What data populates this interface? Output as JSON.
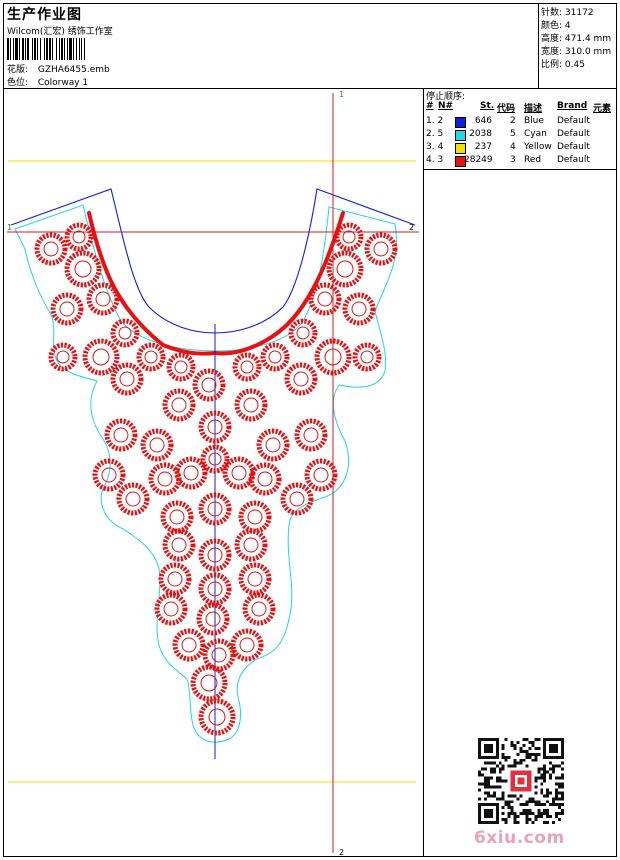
{
  "header": {
    "title": "生产作业图",
    "company": "Wilcom(汇宏) 绣饰工作室",
    "design_label": "花版:",
    "design_value": "GZHA6455.emb",
    "colorway_label": "色位:",
    "colorway_value": "Colorway 1"
  },
  "stats": [
    {
      "label": "针数:",
      "value": "31172"
    },
    {
      "label": "颜色:",
      "value": "4"
    },
    {
      "label": "高度:",
      "value": "471.4 mm"
    },
    {
      "label": "宽度:",
      "value": "310.0 mm"
    },
    {
      "label": "比例:",
      "value": "0.45"
    }
  ],
  "stop_sequence": {
    "title": "停止顺序:",
    "columns": [
      "#",
      "N#",
      "St.",
      "代码",
      "描述",
      "Brand",
      "元素"
    ],
    "rows": [
      {
        "no": "1. 2",
        "color": "#1020d8",
        "stitches": "646",
        "code": "2",
        "desc": "Blue",
        "brand": "Default"
      },
      {
        "no": "2. 5",
        "color": "#22d6e8",
        "stitches": "2038",
        "code": "5",
        "desc": "Cyan",
        "brand": "Default"
      },
      {
        "no": "3. 4",
        "color": "#f0e000",
        "stitches": "237",
        "code": "4",
        "desc": "Yellow",
        "brand": "Default"
      },
      {
        "no": "4. 3",
        "color": "#e81010",
        "stitches": "28249",
        "code": "3",
        "desc": "Red",
        "brand": "Default"
      }
    ]
  },
  "guides": {
    "v_start": "1",
    "v_end": "2",
    "h_start": "1",
    "h_end": "2"
  },
  "brand": {
    "text": "6xiu.com",
    "qr_icon": "qr-code-icon"
  },
  "colors": {
    "blue": "#1020d8",
    "cyan": "#22d6e8",
    "yellow": "#f0e000",
    "red": "#e81010",
    "guide_red": "#d81818",
    "guide_green": "#10a010"
  }
}
